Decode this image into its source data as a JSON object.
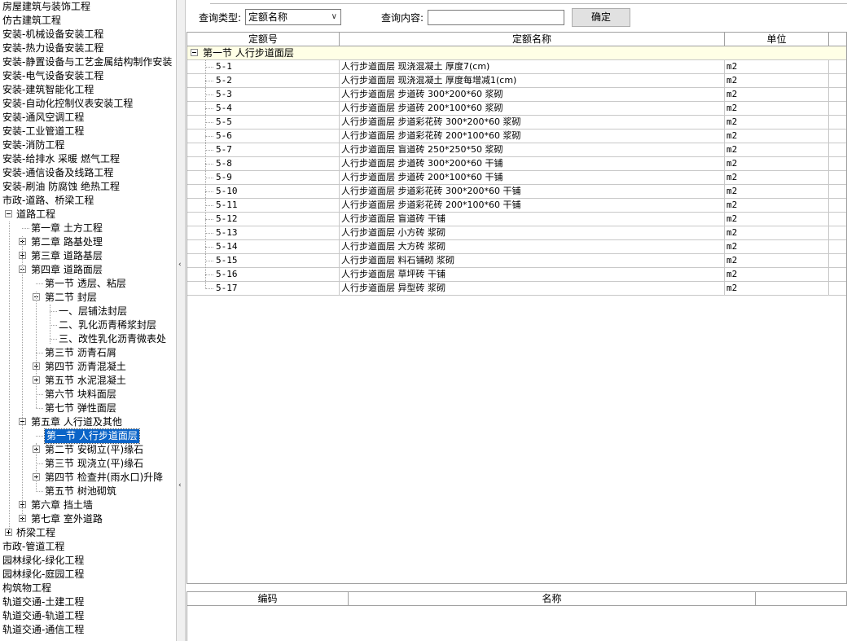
{
  "tree": {
    "items": [
      {
        "label": "房屋建筑与装饰工程"
      },
      {
        "label": "仿古建筑工程"
      },
      {
        "label": "安装-机械设备安装工程"
      },
      {
        "label": "安装-热力设备安装工程"
      },
      {
        "label": "安装-静置设备与工艺金属结构制作安装"
      },
      {
        "label": "安装-电气设备安装工程"
      },
      {
        "label": "安装-建筑智能化工程"
      },
      {
        "label": "安装-自动化控制仪表安装工程"
      },
      {
        "label": "安装-通风空调工程"
      },
      {
        "label": "安装-工业管道工程"
      },
      {
        "label": "安装-消防工程"
      },
      {
        "label": "安装-给排水 采暖 燃气工程"
      },
      {
        "label": "安装-通信设备及线路工程"
      },
      {
        "label": "安装-刷油 防腐蚀 绝热工程"
      },
      {
        "label": "市政-道路、桥梁工程"
      },
      {
        "label": "道路工程",
        "state": "expanded"
      },
      {
        "label": "第一章 土方工程"
      },
      {
        "label": "第二章 路基处理",
        "state": "collapsed"
      },
      {
        "label": "第三章 道路基层",
        "state": "collapsed"
      },
      {
        "label": "第四章 道路面层",
        "state": "expanded"
      },
      {
        "label": "第一节 透层、粘层"
      },
      {
        "label": "第二节 封层",
        "state": "expanded"
      },
      {
        "label": "一、层铺法封层"
      },
      {
        "label": "二、乳化沥青稀浆封层"
      },
      {
        "label": "三、改性乳化沥青微表处"
      },
      {
        "label": "第三节 沥青石屑"
      },
      {
        "label": "第四节 沥青混凝土",
        "state": "collapsed"
      },
      {
        "label": "第五节 水泥混凝土",
        "state": "collapsed"
      },
      {
        "label": "第六节 块料面层"
      },
      {
        "label": "第七节 弹性面层"
      },
      {
        "label": "第五章 人行道及其他",
        "state": "expanded"
      },
      {
        "label": "第一节 人行步道面层",
        "selected": "true"
      },
      {
        "label": "第二节 安砌立(平)缘石",
        "state": "collapsed"
      },
      {
        "label": "第三节 现浇立(平)缘石"
      },
      {
        "label": "第四节 检查井(雨水口)升降",
        "state": "collapsed"
      },
      {
        "label": "第五节 树池砌筑"
      },
      {
        "label": "第六章 挡土墙",
        "state": "collapsed"
      },
      {
        "label": "第七章 室外道路",
        "state": "collapsed"
      },
      {
        "label": "桥梁工程",
        "state": "collapsed"
      },
      {
        "label": "市政-管道工程"
      },
      {
        "label": "园林绿化-绿化工程"
      },
      {
        "label": "园林绿化-庭园工程"
      },
      {
        "label": "构筑物工程"
      },
      {
        "label": "轨道交通-土建工程"
      },
      {
        "label": "轨道交通-轨道工程"
      },
      {
        "label": "轨道交通-通信工程"
      }
    ]
  },
  "query": {
    "type_label": "查询类型:",
    "type_value": "定额名称",
    "content_label": "查询内容:",
    "content_value": "",
    "confirm_label": "确定"
  },
  "grid": {
    "columns": [
      "定额号",
      "定额名称",
      "单位"
    ],
    "group_label": "第一节 人行步道面层",
    "rows": [
      {
        "code": "5-1",
        "name": "人行步道面层 现浇混凝土 厚度7(cm)",
        "unit": "m2"
      },
      {
        "code": "5-2",
        "name": "人行步道面层 现浇混凝土 厚度每增减1(cm)",
        "unit": "m2"
      },
      {
        "code": "5-3",
        "name": "人行步道面层 步道砖 300*200*60 浆砌",
        "unit": "m2"
      },
      {
        "code": "5-4",
        "name": "人行步道面层 步道砖 200*100*60 浆砌",
        "unit": "m2"
      },
      {
        "code": "5-5",
        "name": "人行步道面层 步道彩花砖 300*200*60 浆砌",
        "unit": "m2"
      },
      {
        "code": "5-6",
        "name": "人行步道面层 步道彩花砖 200*100*60 浆砌",
        "unit": "m2"
      },
      {
        "code": "5-7",
        "name": "人行步道面层 盲道砖 250*250*50 浆砌",
        "unit": "m2"
      },
      {
        "code": "5-8",
        "name": "人行步道面层 步道砖 300*200*60 干铺",
        "unit": "m2"
      },
      {
        "code": "5-9",
        "name": "人行步道面层 步道砖 200*100*60 干铺",
        "unit": "m2"
      },
      {
        "code": "5-10",
        "name": "人行步道面层 步道彩花砖 300*200*60 干铺",
        "unit": "m2"
      },
      {
        "code": "5-11",
        "name": "人行步道面层 步道彩花砖 200*100*60 干铺",
        "unit": "m2"
      },
      {
        "code": "5-12",
        "name": "人行步道面层 盲道砖 干铺",
        "unit": "m2"
      },
      {
        "code": "5-13",
        "name": "人行步道面层 小方砖 浆砌",
        "unit": "m2"
      },
      {
        "code": "5-14",
        "name": "人行步道面层 大方砖 浆砌",
        "unit": "m2"
      },
      {
        "code": "5-15",
        "name": "人行步道面层 料石铺砌 浆砌",
        "unit": "m2"
      },
      {
        "code": "5-16",
        "name": "人行步道面层 草坪砖 干铺",
        "unit": "m2"
      },
      {
        "code": "5-17",
        "name": "人行步道面层 异型砖 浆砌",
        "unit": "m2"
      }
    ]
  },
  "bottom_grid": {
    "columns": [
      "编码",
      "名称"
    ]
  }
}
